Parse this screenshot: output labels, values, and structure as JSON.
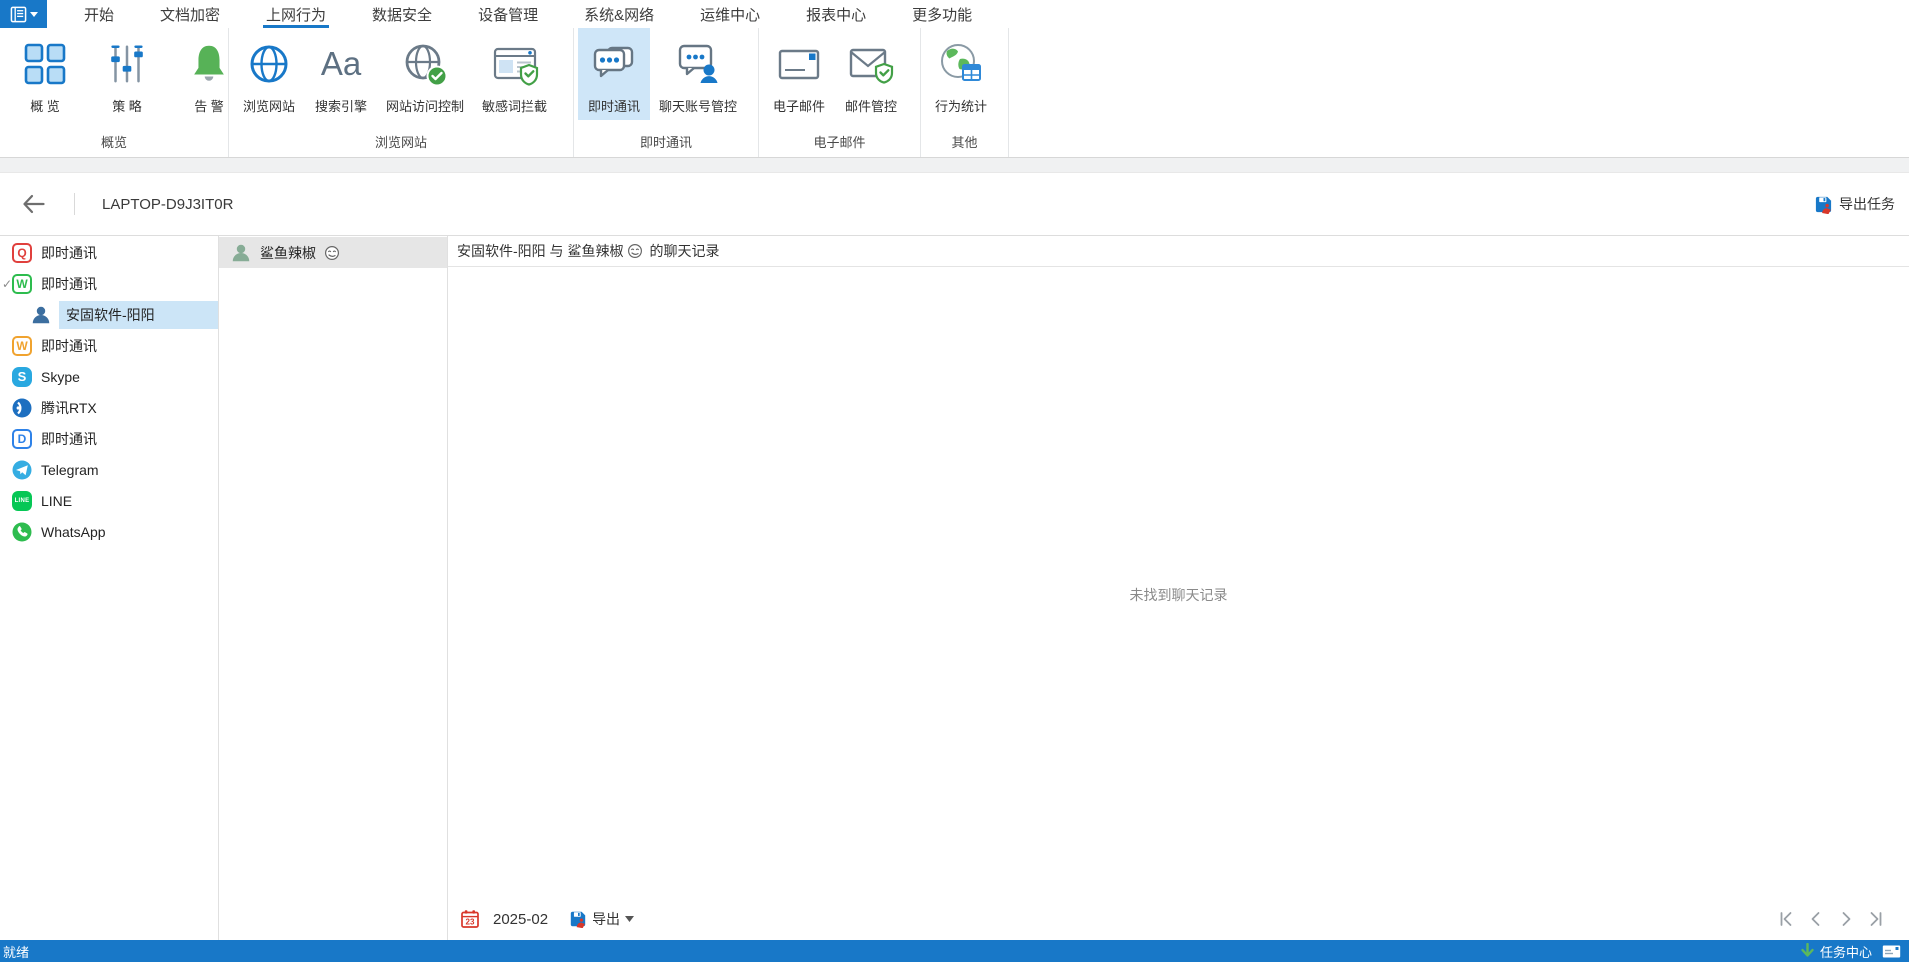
{
  "tabs": [
    {
      "label": "开始"
    },
    {
      "label": "文档加密"
    },
    {
      "label": "上网行为",
      "active": true
    },
    {
      "label": "数据安全"
    },
    {
      "label": "设备管理"
    },
    {
      "label": "系统&网络"
    },
    {
      "label": "运维中心"
    },
    {
      "label": "报表中心"
    },
    {
      "label": "更多功能"
    }
  ],
  "ribbon": {
    "groups": [
      {
        "label": "概览",
        "buttons": [
          {
            "label": "概 览",
            "icon": "overview-grid-icon"
          },
          {
            "label": "策 略",
            "icon": "policy-sliders-icon"
          },
          {
            "label": "告 警",
            "icon": "alert-bell-icon"
          }
        ]
      },
      {
        "label": "浏览网站",
        "buttons": [
          {
            "label": "浏览网站",
            "icon": "browse-globe-icon"
          },
          {
            "label": "搜索引擎",
            "icon": "search-engine-icon",
            "icon_text": "Aa"
          },
          {
            "label": "网站访问控制",
            "icon": "site-access-icon"
          },
          {
            "label": "敏感词拦截",
            "icon": "sensitive-word-block-icon"
          }
        ]
      },
      {
        "label": "即时通讯",
        "buttons": [
          {
            "label": "即时通讯",
            "icon": "im-chat-icon",
            "selected": true
          },
          {
            "label": "聊天账号管控",
            "icon": "chat-account-control-icon"
          }
        ]
      },
      {
        "label": "电子邮件",
        "buttons": [
          {
            "label": "电子邮件",
            "icon": "email-icon"
          },
          {
            "label": "邮件管控",
            "icon": "mail-control-icon"
          }
        ]
      },
      {
        "label": "其他",
        "buttons": [
          {
            "label": "行为统计",
            "icon": "behavior-stats-icon"
          }
        ]
      }
    ]
  },
  "header": {
    "device_name": "LAPTOP-D9J3IT0R",
    "export_task": "导出任务"
  },
  "sidebar": {
    "items": [
      {
        "label": "即时通讯",
        "icon": "qq-icon",
        "letter": "Q"
      },
      {
        "label": "即时通讯",
        "icon": "wechat-icon",
        "letter": "W",
        "expanded": true,
        "expand_mark": "✓"
      },
      {
        "label": "安固软件-阳阳",
        "icon": "user-icon",
        "selected": true
      },
      {
        "label": "即时通讯",
        "icon": "wecom-icon",
        "letter": "W"
      },
      {
        "label": "Skype",
        "icon": "skype-icon",
        "letter": "S"
      },
      {
        "label": "腾讯RTX",
        "icon": "rtx-icon"
      },
      {
        "label": "即时通讯",
        "icon": "dingtalk-icon",
        "letter": "D"
      },
      {
        "label": "Telegram",
        "icon": "telegram-icon"
      },
      {
        "label": "LINE",
        "icon": "line-icon",
        "letter": "LINE"
      },
      {
        "label": "WhatsApp",
        "icon": "whatsapp-icon"
      }
    ]
  },
  "contacts": {
    "items": [
      {
        "name": "鲨鱼辣椒",
        "emoji": "smirk-emoji",
        "selected": true
      }
    ]
  },
  "chat": {
    "title_prefix": "安固软件-阳阳 与 鲨鱼辣椒",
    "title_suffix": "的聊天记录",
    "empty_message": "未找到聊天记录"
  },
  "footer": {
    "calendar_day": "23",
    "month": "2025-02",
    "export_label": "导出"
  },
  "statusbar": {
    "left": "就绪",
    "task_center": "任务中心"
  },
  "colors": {
    "accent_blue": "#1878c8",
    "selection_blue": "#cce5f7",
    "ribbon_selected": "#cfe6f8",
    "selection_gray": "#e6e6e6",
    "green": "#5cb85c",
    "red": "#d8372a"
  }
}
